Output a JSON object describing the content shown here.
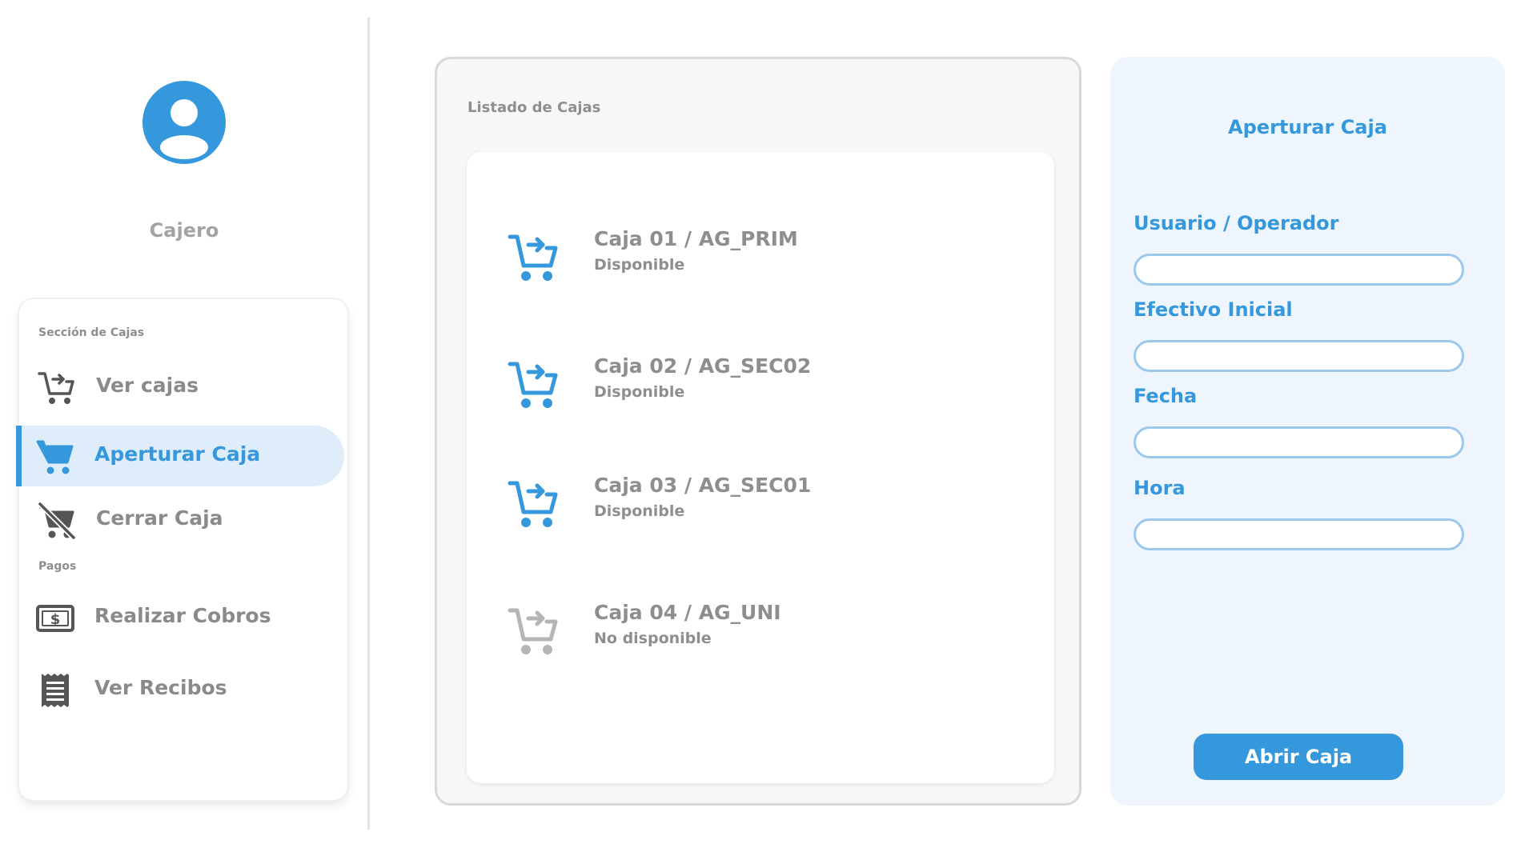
{
  "sidebar": {
    "user_role": "Cajero",
    "sections": {
      "cajas": "Sección de Cajas",
      "pagos": "Pagos"
    },
    "items": [
      {
        "label": "Ver cajas",
        "icon": "cart-arrow-icon",
        "active": false
      },
      {
        "label": "Aperturar Caja",
        "icon": "cart-filled-icon",
        "active": true
      },
      {
        "label": "Cerrar Caja",
        "icon": "cart-off-icon",
        "active": false
      },
      {
        "label": "Realizar Cobros",
        "icon": "cash-icon",
        "active": false
      },
      {
        "label": "Ver Recibos",
        "icon": "receipt-icon",
        "active": false
      }
    ]
  },
  "list": {
    "title": "Listado de Cajas",
    "boxes": [
      {
        "name": "Caja 01 / AG_PRIM",
        "status": "Disponible",
        "available": true
      },
      {
        "name": "Caja 02 / AG_SEC02",
        "status": "Disponible",
        "available": true
      },
      {
        "name": "Caja 03 / AG_SEC01",
        "status": "Disponible",
        "available": true
      },
      {
        "name": "Caja 04 / AG_UNI",
        "status": "No disponible",
        "available": false
      }
    ]
  },
  "form": {
    "title": "Aperturar Caja",
    "fields": [
      {
        "label": "Usuario / Operador",
        "value": ""
      },
      {
        "label": "Efectivo Inicial",
        "value": ""
      },
      {
        "label": "Fecha",
        "value": ""
      },
      {
        "label": "Hora",
        "value": ""
      }
    ],
    "submit_label": "Abrir Caja"
  },
  "colors": {
    "accent": "#3698dc",
    "accent_light": "#deedf9",
    "text_muted": "#8e8e8e",
    "unavailable": "#b5b5b5"
  }
}
